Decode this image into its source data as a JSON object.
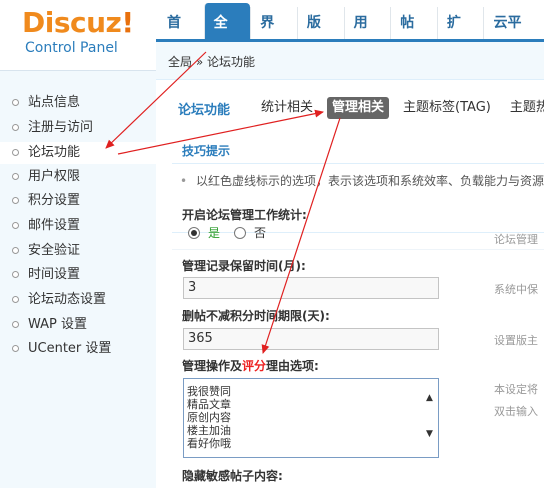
{
  "logo": {
    "brand": "Discuz",
    "brand_mark": "!",
    "sub": "Control Panel"
  },
  "topnav": [
    {
      "label": "首页",
      "active": false
    },
    {
      "label": "全局",
      "active": true
    },
    {
      "label": "界面",
      "active": false
    },
    {
      "label": "版块",
      "active": false
    },
    {
      "label": "用户",
      "active": false
    },
    {
      "label": "帖子",
      "active": false
    },
    {
      "label": "扩展",
      "active": false
    },
    {
      "label": "云平台",
      "active": false
    }
  ],
  "sidebar": {
    "items": [
      {
        "label": "站点信息"
      },
      {
        "label": "注册与访问"
      },
      {
        "label": "论坛功能"
      },
      {
        "label": "用户权限"
      },
      {
        "label": "积分设置"
      },
      {
        "label": "邮件设置"
      },
      {
        "label": "安全验证"
      },
      {
        "label": "时间设置"
      },
      {
        "label": "论坛动态设置"
      },
      {
        "label": "WAP 设置"
      },
      {
        "label": "UCenter 设置"
      }
    ]
  },
  "breadcrumb": {
    "root": "全局",
    "sep": "»",
    "current": "论坛功能"
  },
  "subnav": {
    "title": "论坛功能",
    "tabs": [
      {
        "label": "统计相关"
      },
      {
        "label": "管理相关"
      },
      {
        "label": "主题标签(TAG)"
      },
      {
        "label": "主题热度"
      }
    ]
  },
  "tips": {
    "title": "技巧提示",
    "bullet": "•",
    "text": "以红色虚线标示的选项，表示该选项和系统效率、负载能力与资源"
  },
  "form": {
    "manage_stat": {
      "label": "开启论坛管理工作统计:",
      "yes": "是",
      "no": "否",
      "tip": "论坛管理"
    },
    "log_keep": {
      "label": "管理记录保留时间(月):",
      "value": "3",
      "tip": "系统中保"
    },
    "delete_limit": {
      "label": "删帖不减积分时间期限(天):",
      "value": "365",
      "tip": "设置版主"
    },
    "reasons": {
      "label_a": "管理操作及",
      "label_red": "评分",
      "label_b": "理由选项:",
      "lines": [
        "我很赞同",
        "精品文章",
        "原创内容",
        "楼主加油",
        "看好你哦"
      ],
      "tip1": "本设定将",
      "tip2": "双击输入"
    },
    "hidden_posts": {
      "label": "隐藏敏感帖子内容:"
    }
  },
  "colors": {
    "brand_orange": "#f08a1d",
    "nav_blue": "#2b7dbc",
    "annotation_red": "#e02020"
  }
}
